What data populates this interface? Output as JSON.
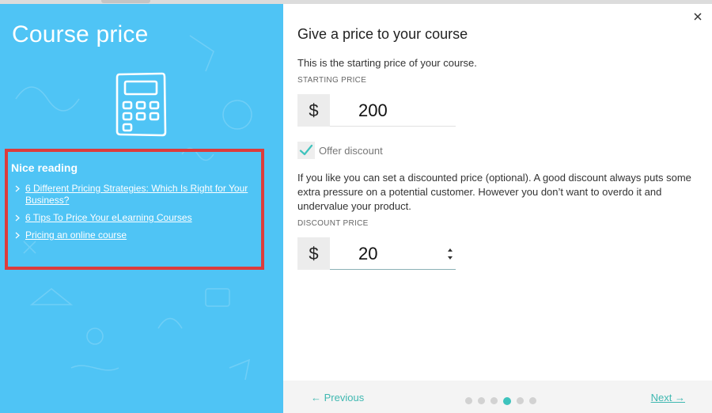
{
  "left_panel": {
    "title": "Course price",
    "reading": {
      "title": "Nice reading",
      "links": [
        "6 Different Pricing Strategies: Which Is Right for Your Business?",
        "6 Tips To Price Your eLearning Courses",
        "Pricing an online course"
      ]
    },
    "highlight_color": "#dc3c3c",
    "background_color": "#4fc4f5"
  },
  "dialog": {
    "heading": "Give a price to your course",
    "intro": "This is the starting price of your course.",
    "starting_price": {
      "label": "STARTING PRICE",
      "currency": "$",
      "value": "200"
    },
    "offer_discount": {
      "label": "Offer discount",
      "checked": true
    },
    "help_text": "If you like you can set a discounted price (optional). A good discount always puts some extra pressure on a potential customer. However you don’t want to overdo it and undervalue your product.",
    "discount_price": {
      "label": "DISCOUNT PRICE",
      "currency": "$",
      "value": "20"
    },
    "close_icon": "close-icon"
  },
  "footer": {
    "previous_label": "← Previous",
    "next_label": "Next →",
    "steps_total": 6,
    "current_step": 4,
    "accent_color": "#3ec3bd"
  }
}
